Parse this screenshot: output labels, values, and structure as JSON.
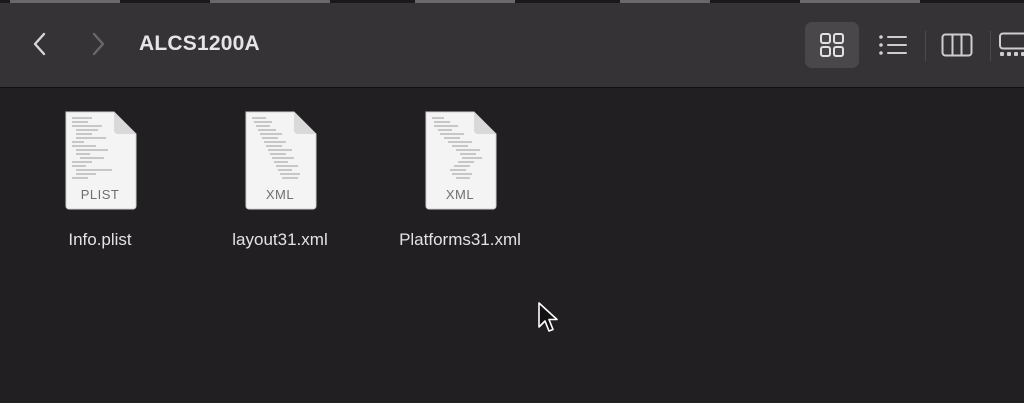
{
  "window": {
    "title": "ALCS1200A"
  },
  "toolbar": {
    "back_icon": "chevron-left-icon",
    "forward_icon": "chevron-right-icon",
    "view_modes": [
      {
        "name": "icon-view",
        "icon": "grid-icon",
        "selected": true
      },
      {
        "name": "list-view",
        "icon": "list-icon",
        "selected": false
      },
      {
        "name": "column-view",
        "icon": "columns-icon",
        "selected": false
      },
      {
        "name": "gallery-view",
        "icon": "gallery-icon",
        "selected": false
      }
    ]
  },
  "files": [
    {
      "name": "Info.plist",
      "ext_label": "PLIST"
    },
    {
      "name": "layout31.xml",
      "ext_label": "XML"
    },
    {
      "name": "Platforms31.xml",
      "ext_label": "XML"
    }
  ],
  "colors": {
    "toolbar_bg": "#363336",
    "content_bg": "#221f22",
    "selected_view_bg": "#4a474a",
    "text": "#e4e2e4"
  }
}
